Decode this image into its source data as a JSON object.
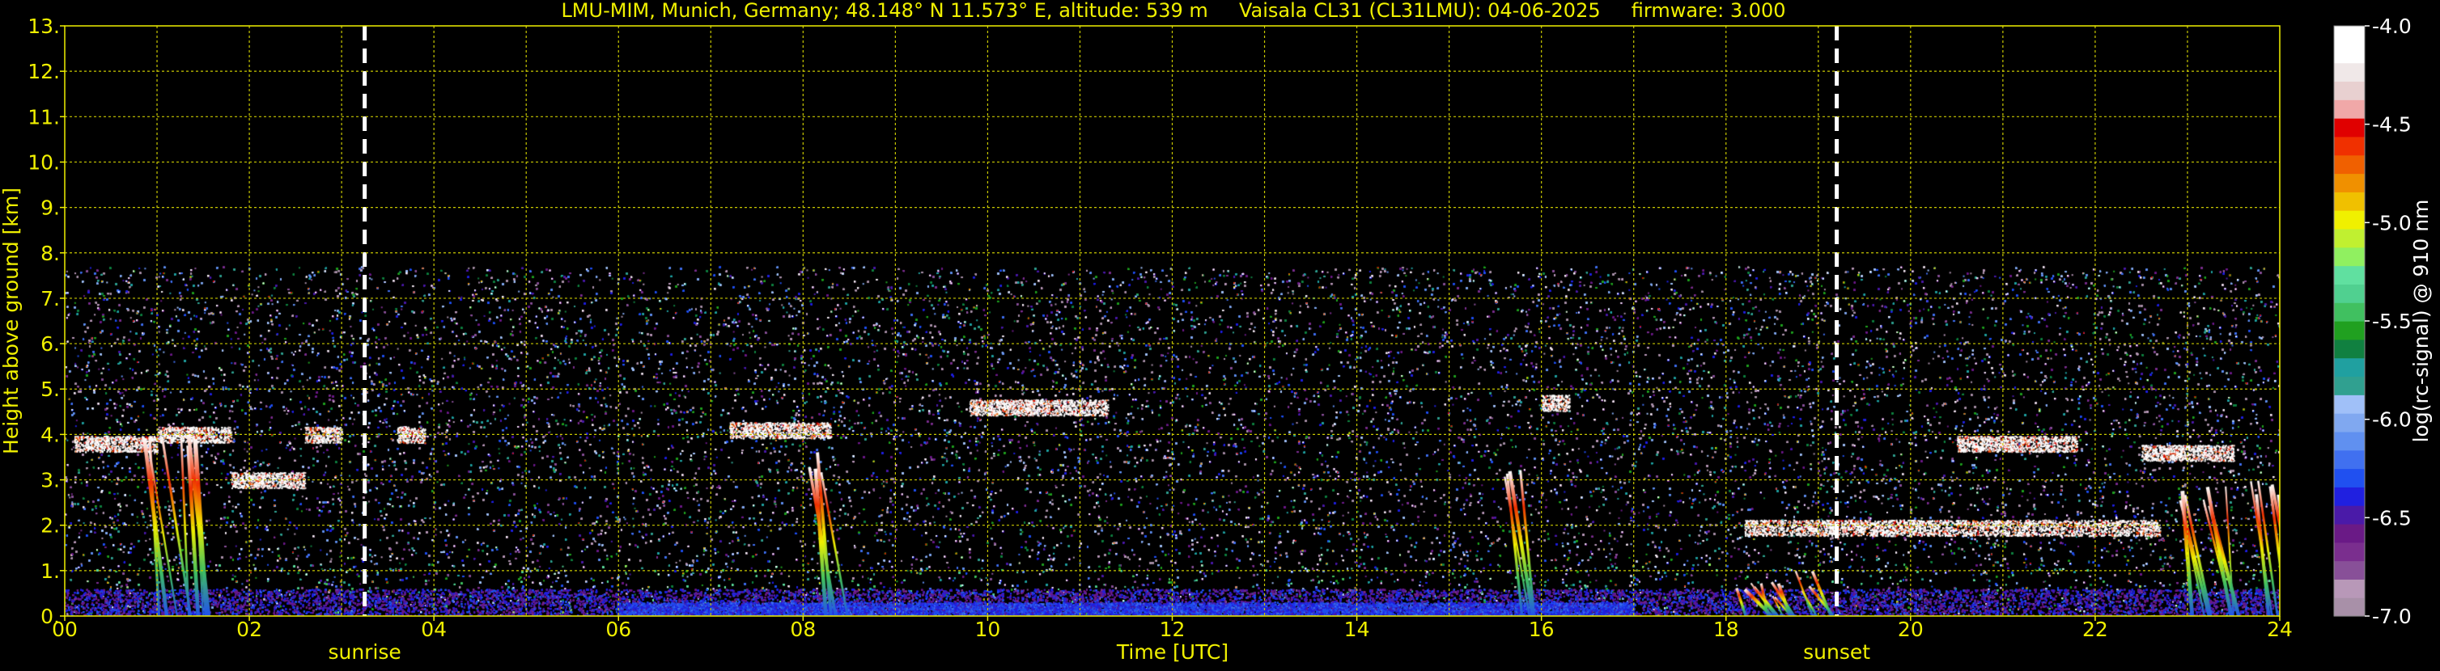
{
  "chart_data": {
    "type": "heatmap",
    "title": "LMU-MIM, Munich, Germany; 48.148° N 11.573° E, altitude: 539 m     Vaisala CL31 (CL31LMU): 04-06-2025     firmware: 3.000",
    "xlabel": "Time [UTC]",
    "ylabel": "Height above ground [km]",
    "xlim": [
      0,
      24
    ],
    "ylim": [
      0,
      13
    ],
    "x_ticks": [
      "00",
      "02",
      "04",
      "06",
      "08",
      "10",
      "12",
      "14",
      "16",
      "18",
      "20",
      "22",
      "24"
    ],
    "y_ticks": [
      "0.",
      "1.",
      "2.",
      "3.",
      "4.",
      "5.",
      "6.",
      "7.",
      "8.",
      "9.",
      "10.",
      "11.",
      "12.",
      "13."
    ],
    "grid": true,
    "colorbar": {
      "label": "log(rc-signal) @ 910 nm",
      "range": [
        -7.0,
        -4.0
      ],
      "ticks": [
        "-4.0",
        "-4.5",
        "-5.0",
        "-5.5",
        "-6.0",
        "-6.5",
        "-7.0"
      ],
      "tick_values": [
        -4.0,
        -4.5,
        -5.0,
        -5.5,
        -6.0,
        -6.5,
        -7.0
      ],
      "colors": [
        "#a890a8",
        "#b898b8",
        "#885098",
        "#7a2e8e",
        "#6a1a86",
        "#4a1aa8",
        "#2020e0",
        "#2050f0",
        "#4070f0",
        "#6090f0",
        "#80a8f0",
        "#a0c0f8",
        "#30a090",
        "#20a0a0",
        "#108040",
        "#20a020",
        "#40c060",
        "#50d090",
        "#60e0a0",
        "#90f060",
        "#c0f030",
        "#f0f000",
        "#f0c000",
        "#f09000",
        "#f06000",
        "#f03000",
        "#e00000",
        "#f0a8a8",
        "#e8d0d0",
        "#f0e8e8",
        "#ffffff",
        "#ffffff"
      ]
    },
    "events": [
      {
        "label": "sunrise",
        "time": 3.25
      },
      {
        "label": "sunset",
        "time": 19.2
      }
    ],
    "data_top_height_km": 7.7,
    "cloud_layers": [
      {
        "t0": 0.1,
        "t1": 1.0,
        "h": 3.8
      },
      {
        "t0": 1.0,
        "t1": 1.8,
        "h": 4.0
      },
      {
        "t0": 1.8,
        "t1": 2.6,
        "h": 3.0
      },
      {
        "t0": 2.6,
        "t1": 3.0,
        "h": 4.0
      },
      {
        "t0": 3.6,
        "t1": 3.9,
        "h": 4.0
      },
      {
        "t0": 7.2,
        "t1": 8.3,
        "h": 4.1
      },
      {
        "t0": 9.8,
        "t1": 11.3,
        "h": 4.6
      },
      {
        "t0": 16.0,
        "t1": 16.3,
        "h": 4.7
      },
      {
        "t0": 18.2,
        "t1": 22.7,
        "h": 1.95
      },
      {
        "t0": 20.5,
        "t1": 21.8,
        "h": 3.8
      },
      {
        "t0": 22.5,
        "t1": 23.5,
        "h": 3.6
      }
    ],
    "precipitation_streaks": [
      {
        "t0": 0.8,
        "t1": 1.5,
        "h": 4.2
      },
      {
        "t0": 8.0,
        "t1": 8.3,
        "h": 3.7
      },
      {
        "t0": 15.6,
        "t1": 15.8,
        "h": 3.4
      },
      {
        "t0": 18.1,
        "t1": 19.0,
        "h": 1.0
      },
      {
        "t0": 22.9,
        "t1": 24.0,
        "h": 3.0
      }
    ]
  }
}
